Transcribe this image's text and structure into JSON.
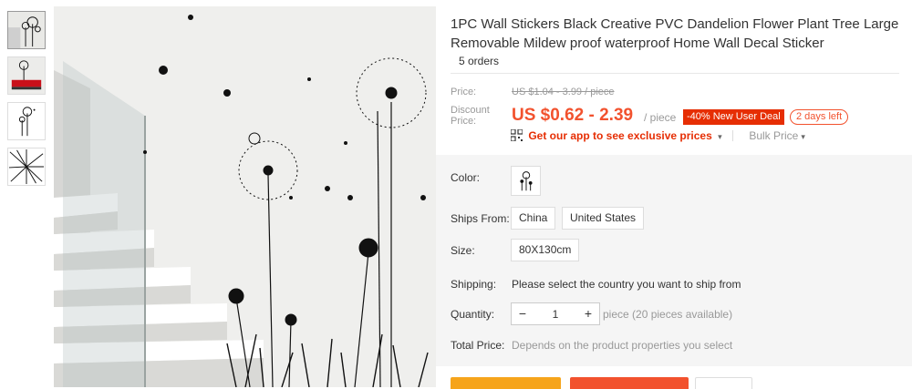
{
  "product": {
    "title": "1PC Wall Stickers Black Creative PVC Dandelion Flower Plant Tree Large Removable Mildew proof waterproof Home Wall Decal Sticker",
    "orders": "5 orders"
  },
  "price": {
    "label": "Price:",
    "original": "US $1.04 - 3.99 / piece",
    "discount_label": "Discount Price:",
    "discount_value": "US $0.62 - 2.39",
    "unit": "/ piece",
    "promo": "-40% New User Deal",
    "time_left": "2 days left",
    "app_promo": "Get our app to see exclusive prices",
    "bulk": "Bulk Price"
  },
  "options": {
    "color_label": "Color:",
    "ships_label": "Ships From:",
    "ships_options": [
      "China",
      "United States"
    ],
    "size_label": "Size:",
    "size_value": "80X130cm",
    "shipping_label": "Shipping:",
    "shipping_text": "Please select the country you want to ship from",
    "quantity_label": "Quantity:",
    "quantity_value": "1",
    "quantity_note": "piece (20 pieces available)",
    "total_label": "Total Price:",
    "total_text": "Depends on the product properties you select"
  },
  "icons": {
    "minus": "−",
    "plus": "+",
    "caret": "▾"
  },
  "colors": {
    "accent": "#f2522e",
    "promo_bg": "#e62e04",
    "buy_button": "#f6a41b"
  }
}
